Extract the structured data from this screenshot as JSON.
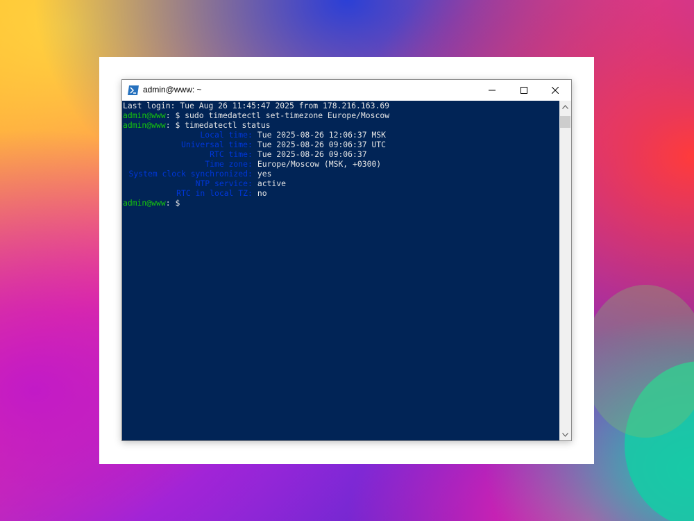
{
  "window": {
    "title": "admin@www: ~",
    "icon": "powershell-icon"
  },
  "colors": {
    "terminal_bg": "#012456",
    "prompt_green": "#16c60c",
    "key_blue": "#0037da",
    "text": "#e6e6e6"
  },
  "terminal": {
    "last_login": "Last login: Tue Aug 26 11:45:47 2025 from 178.216.163.69",
    "prompt_user": "admin@www",
    "prompt_suffix": ": $ ",
    "cmd1": "sudo timedatectl set-timezone Europe/Moscow",
    "cmd2": "timedatectl status",
    "status": [
      {
        "key": "Local time",
        "value": "Tue 2025-08-26 12:06:37 MSK"
      },
      {
        "key": "Universal time",
        "value": "Tue 2025-08-26 09:06:37 UTC"
      },
      {
        "key": "RTC time",
        "value": "Tue 2025-08-26 09:06:37"
      },
      {
        "key": "Time zone",
        "value": "Europe/Moscow (MSK, +0300)"
      },
      {
        "key": "System clock synchronized",
        "value": "yes"
      },
      {
        "key": "NTP service",
        "value": "active"
      },
      {
        "key": "RTC in local TZ",
        "value": "no"
      }
    ]
  }
}
